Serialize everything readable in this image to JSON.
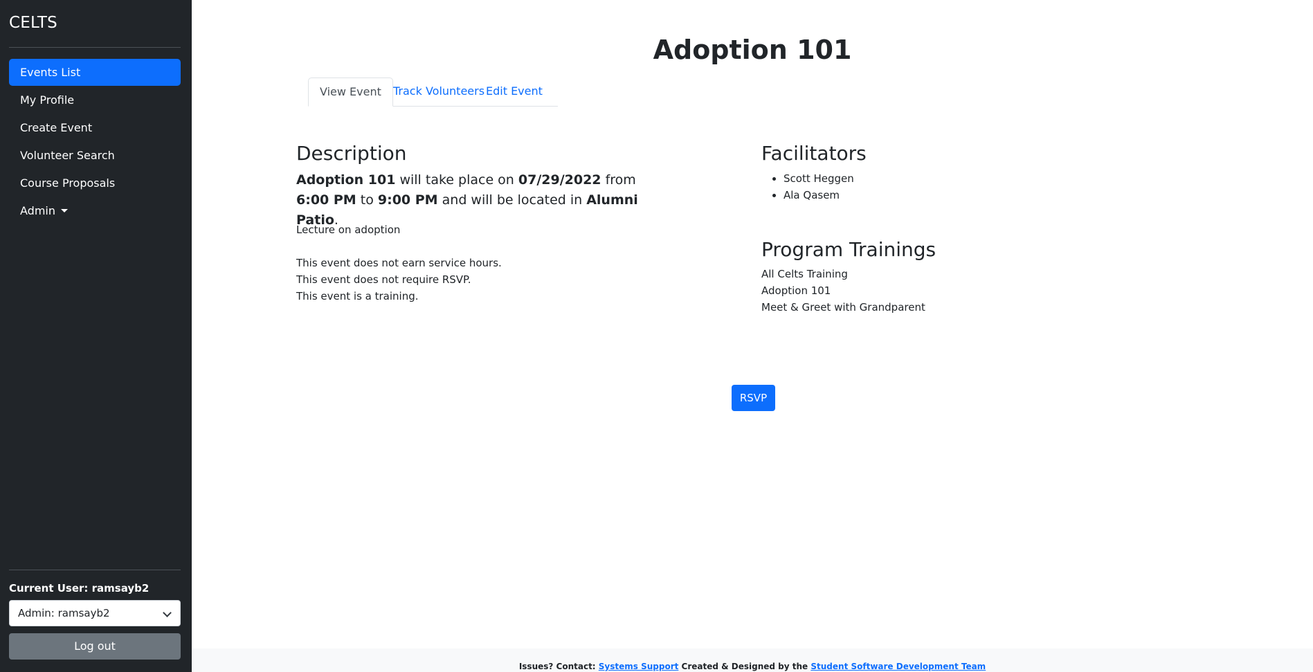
{
  "sidebar": {
    "brand": "CELTS",
    "nav": [
      {
        "label": "Events List",
        "active": true
      },
      {
        "label": "My Profile"
      },
      {
        "label": "Create Event"
      },
      {
        "label": "Volunteer Search"
      },
      {
        "label": "Course Proposals"
      },
      {
        "label": "Admin"
      }
    ],
    "current_user_label": "Current User: ramsayb2",
    "user_select_value": "Admin: ramsayb2",
    "logout_label": "Log out"
  },
  "page": {
    "title": "Adoption 101",
    "tabs": [
      {
        "label": "View Event",
        "active": true
      },
      {
        "label": "Track Volunteers"
      },
      {
        "label": "Edit Event"
      }
    ]
  },
  "description": {
    "heading": "Description",
    "event_name": "Adoption 101",
    "text_take_place": " will take place on ",
    "date": "07/29/2022",
    "text_from": " from ",
    "start_time": "6:00 PM",
    "text_to": " to ",
    "end_time": "9:00 PM",
    "text_located": " and will be located in ",
    "location": "Alumni Patio",
    "text_period": ".",
    "summary": "Lecture on adoption",
    "service_hours": "This event does not earn service hours.",
    "rsvp_note": "This event does not require RSVP.",
    "training_note": "This event is a training."
  },
  "facilitators": {
    "heading": "Facilitators",
    "items": [
      "Scott Heggen",
      "Ala Qasem"
    ]
  },
  "program_trainings": {
    "heading": "Program Trainings",
    "items": [
      "All Celts Training",
      "Adoption 101",
      "Meet & Greet with Grandparent"
    ]
  },
  "rsvp_button": "RSVP",
  "footer": {
    "issues": "Issues? Contact: ",
    "support_link": "Systems Support",
    "created": " Created & Designed by the ",
    "team_link": "Student Software Development Team"
  },
  "colors": {
    "sidebar_bg": "#212529",
    "primary": "#0d6efd",
    "secondary": "#6c757d"
  }
}
